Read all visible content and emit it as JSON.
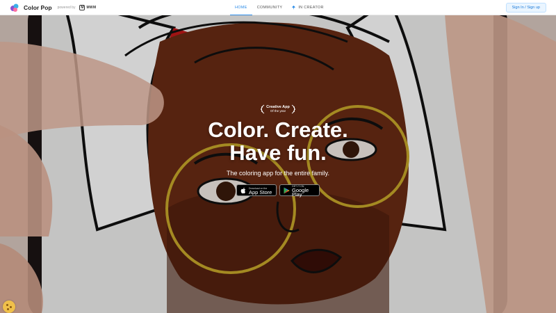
{
  "header": {
    "brand_name": "Color Pop",
    "powered_by": "powered by",
    "partner": "MWM",
    "partner_badge": "M",
    "nav": [
      {
        "label": "HOME",
        "active": true
      },
      {
        "label": "COMMUNITY",
        "active": false
      },
      {
        "label": "IN CREATOR",
        "active": false
      }
    ],
    "signin_label": "Sign In / Sign up",
    "accent_color": "#2a8be8"
  },
  "hero": {
    "award_title": "Creative App",
    "award_sub": "Of the year",
    "headline_line1": "Color. Create.",
    "headline_line2": "Have fun.",
    "tagline": "The coloring app for the entire family.",
    "app_store": {
      "small": "Download on the",
      "big": "App Store",
      "icon": "apple-icon"
    },
    "google_play": {
      "small": "GET IT ON",
      "big": "Google Play",
      "icon": "google-play-icon"
    }
  },
  "cookie": {
    "icon": "cookie-icon"
  }
}
